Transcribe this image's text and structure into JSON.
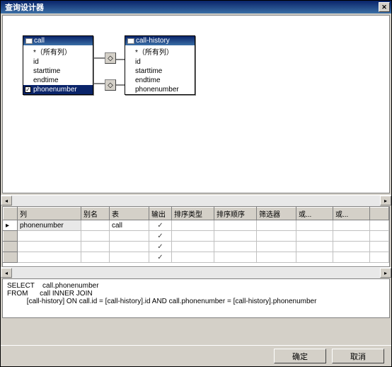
{
  "titlebar": {
    "title": "查询设计器"
  },
  "tables": {
    "call": {
      "name": "call",
      "rows": [
        "*（所有列）",
        "id",
        "starttime",
        "endtime",
        "phonenumber"
      ],
      "selectedIndex": 4
    },
    "callhistory": {
      "name": "call-history",
      "rows": [
        "*（所有列）",
        "id",
        "starttime",
        "endtime",
        "phonenumber"
      ]
    }
  },
  "grid": {
    "headers": {
      "col": "列",
      "alias": "别名",
      "table": "表",
      "output": "输出",
      "sorttype": "排序类型",
      "sortorder": "排序顺序",
      "filter": "筛选器",
      "or1": "或...",
      "or2": "或..."
    },
    "rows": [
      {
        "col": "phonenumber",
        "alias": "",
        "table": "call",
        "output": "✓"
      },
      {
        "col": "",
        "alias": "",
        "table": "",
        "output": "✓"
      },
      {
        "col": "",
        "alias": "",
        "table": "",
        "output": "✓"
      },
      {
        "col": "",
        "alias": "",
        "table": "",
        "output": "✓"
      }
    ]
  },
  "sql": {
    "kw_select": "SELECT",
    "kw_from": "FROM",
    "select_expr": "call.phonenumber",
    "from_expr": "call INNER JOIN",
    "join_expr": "[call-history] ON call.id = [call-history].id AND call.phonenumber = [call-history].phonenumber"
  },
  "buttons": {
    "ok": "确定",
    "cancel": "取消"
  }
}
